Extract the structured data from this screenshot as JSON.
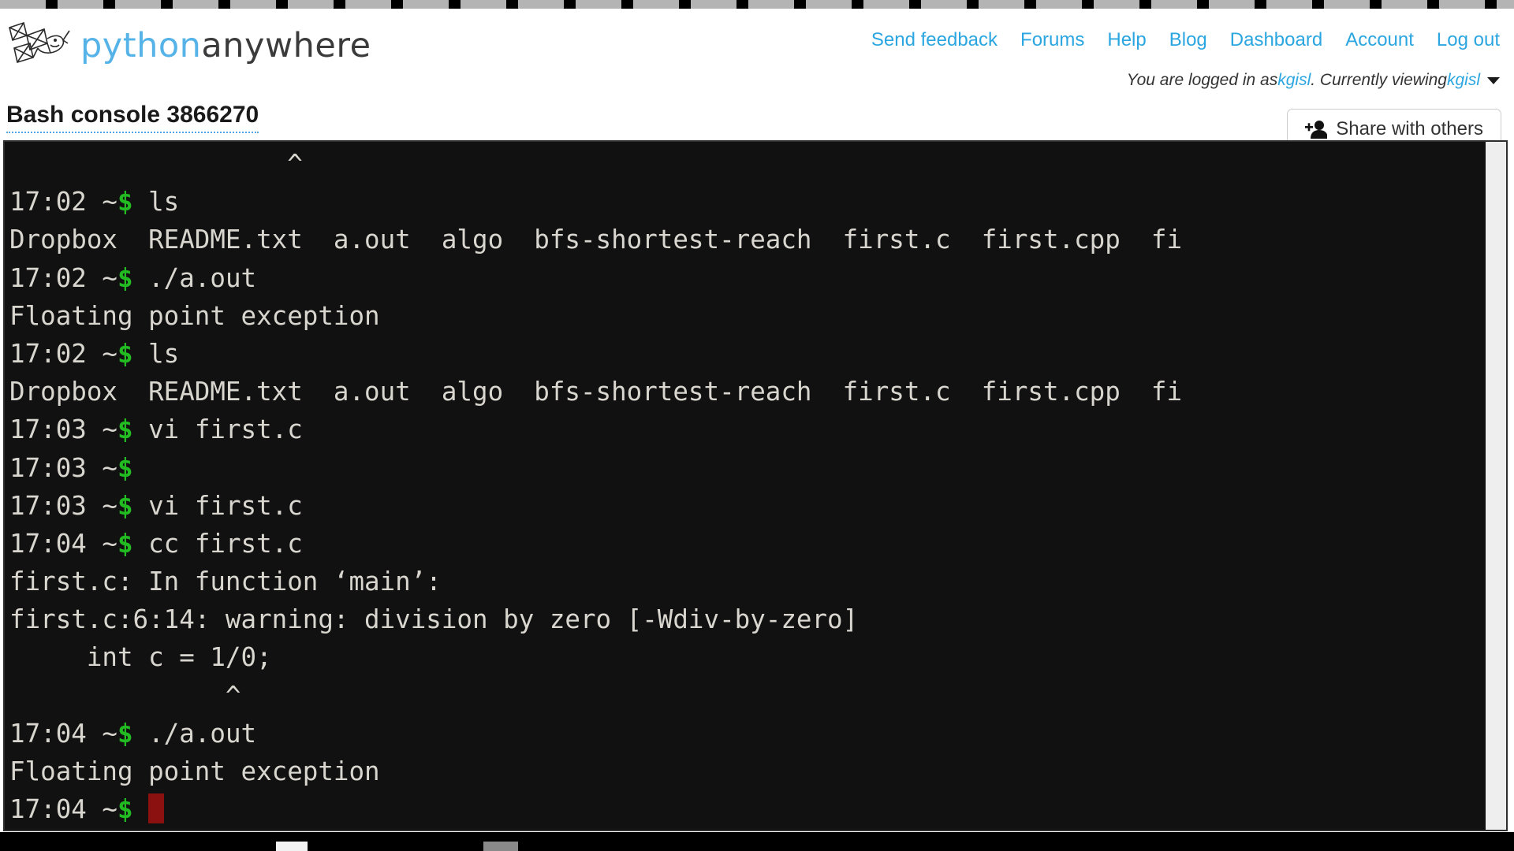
{
  "header": {
    "logo": {
      "icon_name": "pythonanywhere-logo-icon",
      "word_python": "python",
      "word_anywhere": "anywhere"
    },
    "nav_links": [
      {
        "label": "Send feedback",
        "name": "nav-send-feedback"
      },
      {
        "label": "Forums",
        "name": "nav-forums"
      },
      {
        "label": "Help",
        "name": "nav-help"
      },
      {
        "label": "Blog",
        "name": "nav-blog"
      },
      {
        "label": "Dashboard",
        "name": "nav-dashboard"
      },
      {
        "label": "Account",
        "name": "nav-account"
      },
      {
        "label": "Log out",
        "name": "nav-log-out"
      }
    ],
    "login_status": {
      "prefix": "You are logged in as ",
      "user": "kgisl",
      "middle": ". Currently viewing ",
      "viewing_user": "kgisl"
    },
    "console_title": "Bash console 3866270",
    "share_button": {
      "label": "Share with others",
      "icon_name": "person-add-icon"
    }
  },
  "terminal": {
    "colors": {
      "background": "#111111",
      "foreground": "#d9d6cf",
      "prompt_dollar": "#22bb22",
      "cursor": "#8b1010"
    },
    "lines": [
      {
        "type": "plain",
        "text": "                  ^"
      },
      {
        "type": "prompt",
        "time": "17:02",
        "cwd": "~",
        "sigil": "$",
        "command": " ls"
      },
      {
        "type": "plain",
        "text": "Dropbox  README.txt  a.out  algo  bfs-shortest-reach  first.c  first.cpp  fi"
      },
      {
        "type": "prompt",
        "time": "17:02",
        "cwd": "~",
        "sigil": "$",
        "command": " ./a.out"
      },
      {
        "type": "plain",
        "text": "Floating point exception"
      },
      {
        "type": "prompt",
        "time": "17:02",
        "cwd": "~",
        "sigil": "$",
        "command": " ls"
      },
      {
        "type": "plain",
        "text": "Dropbox  README.txt  a.out  algo  bfs-shortest-reach  first.c  first.cpp  fi"
      },
      {
        "type": "prompt",
        "time": "17:03",
        "cwd": "~",
        "sigil": "$",
        "command": " vi first.c"
      },
      {
        "type": "prompt",
        "time": "17:03",
        "cwd": "~",
        "sigil": "$",
        "command": ""
      },
      {
        "type": "prompt",
        "time": "17:03",
        "cwd": "~",
        "sigil": "$",
        "command": " vi first.c"
      },
      {
        "type": "prompt",
        "time": "17:04",
        "cwd": "~",
        "sigil": "$",
        "command": " cc first.c"
      },
      {
        "type": "plain",
        "text": "first.c: In function ‘main’:"
      },
      {
        "type": "plain",
        "text": "first.c:6:14: warning: division by zero [-Wdiv-by-zero]"
      },
      {
        "type": "plain",
        "text": "     int c = 1/0;"
      },
      {
        "type": "plain",
        "text": "              ^"
      },
      {
        "type": "prompt",
        "time": "17:04",
        "cwd": "~",
        "sigil": "$",
        "command": " ./a.out"
      },
      {
        "type": "plain",
        "text": "Floating point exception"
      },
      {
        "type": "cursor-prompt",
        "time": "17:04",
        "cwd": "~",
        "sigil": "$",
        "command": " "
      }
    ]
  }
}
